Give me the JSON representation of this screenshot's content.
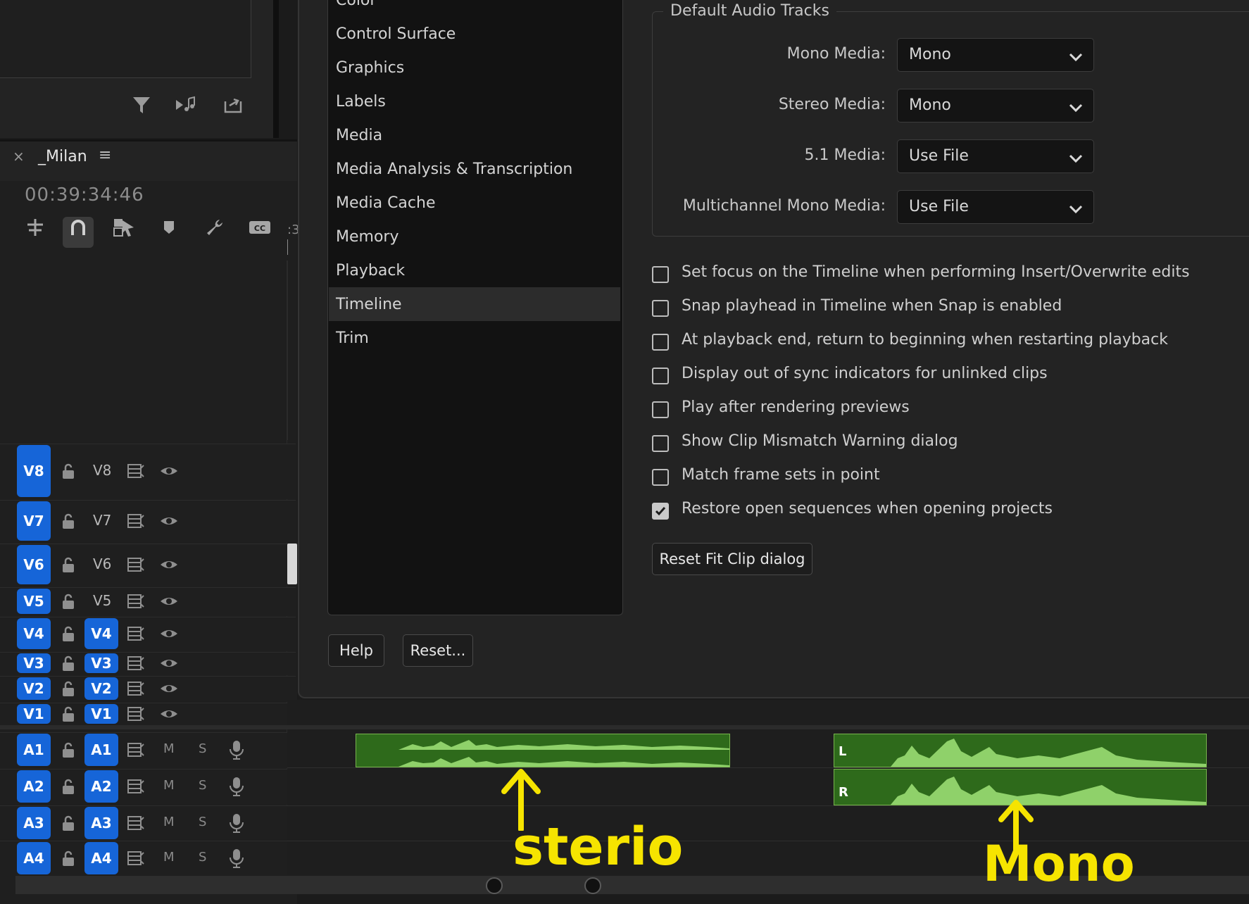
{
  "source_panel": {
    "buttons": [
      "filter-icon",
      "insert-audio-icon",
      "export-icon"
    ]
  },
  "timeline": {
    "close_glyph": "×",
    "sequence_name": "_Milan",
    "menu_glyph": "≡",
    "timecode": "00:39:34:46",
    "ruler_mark": ":3",
    "tools": [
      "nest-icon",
      "snap-icon",
      "linked-selection-icon",
      "marker-icon",
      "wrench-icon",
      "captions-icon"
    ],
    "video_tracks": [
      {
        "target": "V8",
        "name": "V8",
        "source_patch": ""
      },
      {
        "target": "V7",
        "name": "V7",
        "source_patch": ""
      },
      {
        "target": "V6",
        "name": "V6",
        "source_patch": ""
      },
      {
        "target": "V5",
        "name": "V5",
        "source_patch": ""
      },
      {
        "target": "V4",
        "name": "",
        "source_patch": "V4"
      },
      {
        "target": "V3",
        "name": "",
        "source_patch": "V3"
      },
      {
        "target": "V2",
        "name": "",
        "source_patch": "V2"
      },
      {
        "target": "V1",
        "name": "",
        "source_patch": "V1"
      }
    ],
    "audio_tracks": [
      {
        "target": "A1",
        "source_patch": "A1",
        "mute": "M",
        "solo": "S"
      },
      {
        "target": "A2",
        "source_patch": "A2",
        "mute": "M",
        "solo": "S"
      },
      {
        "target": "A3",
        "source_patch": "A3",
        "mute": "M",
        "solo": "S"
      },
      {
        "target": "A4",
        "source_patch": "A4",
        "mute": "M",
        "solo": "S"
      }
    ],
    "clips": {
      "stereo_clip_channels": [],
      "mono_clip_channels": [
        "L",
        "R"
      ]
    }
  },
  "preferences": {
    "categories": [
      "Color",
      "Control Surface",
      "Graphics",
      "Labels",
      "Media",
      "Media Analysis & Transcription",
      "Media Cache",
      "Memory",
      "Playback",
      "Timeline",
      "Trim"
    ],
    "selected_category": "Timeline",
    "default_audio_tracks": {
      "title": "Default Audio Tracks",
      "fields": [
        {
          "label": "Mono Media:",
          "value": "Mono"
        },
        {
          "label": "Stereo Media:",
          "value": "Mono"
        },
        {
          "label": "5.1 Media:",
          "value": "Use File"
        },
        {
          "label": "Multichannel Mono Media:",
          "value": "Use File"
        }
      ]
    },
    "checkboxes": [
      {
        "label": "Set focus on the Timeline when performing Insert/Overwrite edits",
        "checked": false
      },
      {
        "label": "Snap playhead in Timeline when Snap is enabled",
        "checked": false
      },
      {
        "label": "At playback end, return to beginning when restarting playback",
        "checked": false
      },
      {
        "label": "Display out of sync indicators for unlinked clips",
        "checked": false
      },
      {
        "label": "Play after rendering previews",
        "checked": false
      },
      {
        "label": "Show Clip Mismatch Warning dialog",
        "checked": false
      },
      {
        "label": "Match frame sets in point",
        "checked": false
      },
      {
        "label": "Restore open sequences when opening projects",
        "checked": true
      }
    ],
    "reset_fit_clip_label": "Reset Fit Clip dialog",
    "help_label": "Help",
    "reset_label": "Reset..."
  },
  "annotations": {
    "stereo_note": "sterio",
    "mono_note": "Mono",
    "color": "#f6e400"
  },
  "colors": {
    "accent_blue": "#1665d8",
    "clip_green": "#2e6a1b",
    "waveform_green": "#8fd16a"
  }
}
